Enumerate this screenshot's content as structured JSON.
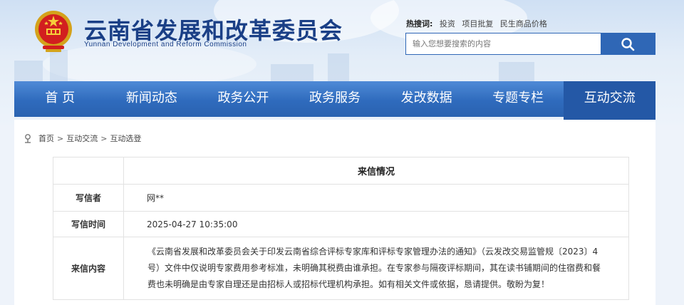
{
  "header": {
    "title": "云南省发展和改革委员会",
    "subtitle": "Yunnan Development and Reform Commission",
    "hot_label": "热搜词:",
    "hot_keywords": [
      "投资",
      "项目批复",
      "民生商品价格"
    ],
    "search_placeholder": "输入您想要搜索的内容"
  },
  "nav": {
    "items": [
      "首 页",
      "新闻动态",
      "政务公开",
      "政务服务",
      "发改数据",
      "专题专栏",
      "互动交流"
    ],
    "active_index": 6
  },
  "breadcrumb": [
    "首页",
    "互动交流",
    "互动选登"
  ],
  "letter": {
    "section_title": "来信情况",
    "writer_label": "写信者",
    "writer_value": "网**",
    "time_label": "写信时间",
    "time_value": "2025-04-27 10:35:00",
    "content_label": "来信内容",
    "content_value": "《云南省发展和改革委员会关于印发云南省综合评标专家库和评标专家管理办法的通知》（云发改交易监管规〔2023〕4号）文件中仅说明专家费用参考标准，未明确其税费由谁承担。在专家参与隔夜评标期间，其在读书铺期间的住宿费和餐费也未明确是由专家自理还是由招标人或招标代理机构承担。如有相关文件或依据，恳请提供。敬盼为复！"
  },
  "colors": {
    "brand": "#1a3f86",
    "nav": "#2f6bbd",
    "nav_active": "#2458a6"
  }
}
